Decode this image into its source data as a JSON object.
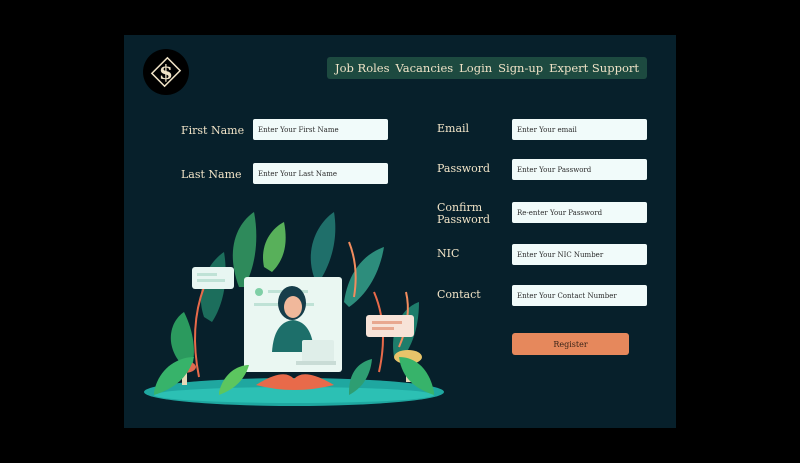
{
  "logo": {
    "glyph": "$",
    "icon": "dollar-emblem-icon"
  },
  "nav": {
    "items": [
      "Job Roles",
      "Vacancies",
      "Login",
      "Sign-up",
      "Expert Support"
    ]
  },
  "form": {
    "first_name": {
      "label": "First Name",
      "placeholder": "Enter Your First Name"
    },
    "last_name": {
      "label": "Last Name",
      "placeholder": "Enter Your Last Name"
    },
    "email": {
      "label": "Email",
      "placeholder": "Enter Your email"
    },
    "password": {
      "label": "Password",
      "placeholder": "Enter Your Password"
    },
    "confirm_password": {
      "label_line1": "Confirm",
      "label_line2": "Password",
      "placeholder": "Re-enter Your Password"
    },
    "nic": {
      "label": "NIC",
      "placeholder": "Enter Your NIC Number"
    },
    "contact": {
      "label": "Contact",
      "placeholder": "Enter Your Contact Number"
    },
    "register_label": "Register"
  },
  "colors": {
    "panel": "#07202b",
    "nav_bg": "#1d4a40",
    "label": "#f0e3c7",
    "button": "#e6885c",
    "input_bg": "#f1fbfa"
  }
}
